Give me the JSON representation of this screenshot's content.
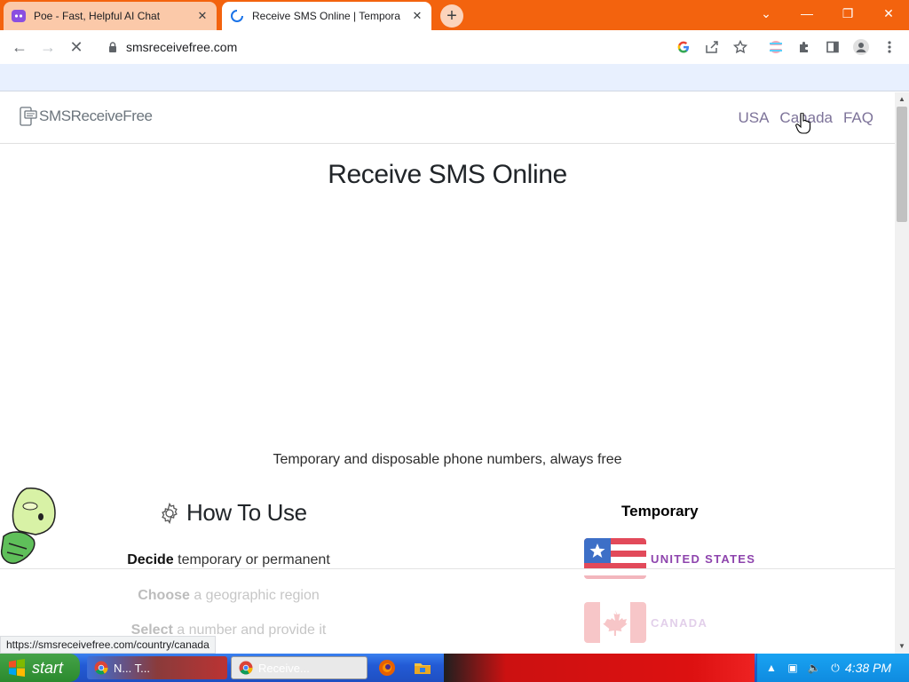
{
  "browser": {
    "tabs": [
      {
        "title": "Poe - Fast, Helpful AI Chat",
        "active": false,
        "close": "✕"
      },
      {
        "title": "Receive SMS Online | Tempora",
        "active": true,
        "close": "✕"
      }
    ],
    "new_tab": "+",
    "window_controls": {
      "collapse": "⌄",
      "minimize": "—",
      "restore": "❐",
      "close": "✕"
    },
    "address": "smsreceivefree.com",
    "nav_icons": {
      "back": "←",
      "forward": "→",
      "stop": "✕"
    },
    "toolbar_icons": [
      "google-icon",
      "share-icon",
      "star-icon",
      "extension-color-icon",
      "puzzle-icon",
      "sidepanel-icon",
      "profile-icon",
      "menu-icon"
    ],
    "status_url": "https://smsreceivefree.com/country/canada"
  },
  "site": {
    "logo_text": "SMSReceiveFree",
    "nav": [
      "USA",
      "Canada",
      "FAQ"
    ],
    "title": "Receive SMS Online",
    "tagline": "Temporary and disposable phone numbers, always free",
    "how_to_title": "How To Use",
    "steps": [
      {
        "bold": "Decide",
        "rest": " temporary or permanent"
      },
      {
        "bold": "Choose",
        "rest": " a geographic region"
      },
      {
        "bold": "Select",
        "rest": " a number and provide it"
      }
    ],
    "temporary_label": "Temporary",
    "countries": [
      "UNITED STATES",
      "CANADA"
    ],
    "accent": "#8e44ad",
    "nav_color": "#7d7399"
  },
  "taskbar": {
    "start": "start",
    "tasks": [
      "N... T...",
      "Receive..."
    ],
    "clock": "4:38 PM"
  }
}
